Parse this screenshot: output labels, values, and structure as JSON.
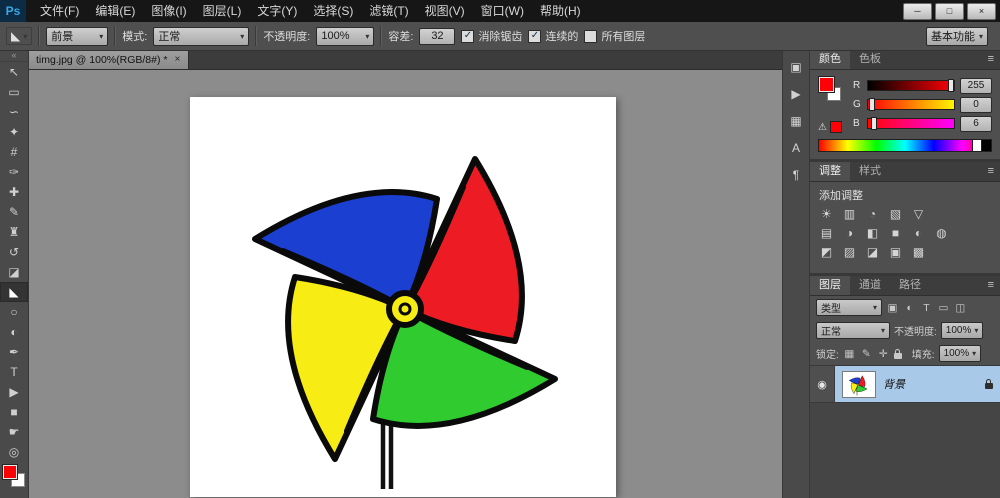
{
  "colors": {
    "foreground": "#ff0006",
    "selected_layer_bg": "#a9c9e9",
    "pinwheel": {
      "red": "#ed1c24",
      "blue": "#1b3fd0",
      "green": "#2fcb2f",
      "yellow": "#f7ec13",
      "outline": "#0a0a0a"
    }
  },
  "titlebar": {
    "logo": "Ps",
    "menus": [
      "文件(F)",
      "编辑(E)",
      "图像(I)",
      "图层(L)",
      "文字(Y)",
      "选择(S)",
      "滤镜(T)",
      "视图(V)",
      "窗口(W)",
      "帮助(H)"
    ],
    "controls": {
      "minimize": "─",
      "maximize": "□",
      "close": "×"
    }
  },
  "options": {
    "tool_icon": "◣",
    "arrow": "▾",
    "source_value": "前景",
    "mode_label": "模式:",
    "mode_value": "正常",
    "opacity_label": "不透明度:",
    "opacity_value": "100%",
    "tolerance_label": "容差:",
    "tolerance_value": "32",
    "checks": [
      {
        "label": "消除锯齿",
        "mark": "✓"
      },
      {
        "label": "连续的",
        "mark": "✓"
      },
      {
        "label": "所有图层",
        "mark": ""
      }
    ],
    "workspace": "基本功能"
  },
  "tabbar": {
    "title": "timg.jpg @ 100%(RGB/8#) *",
    "close": "×"
  },
  "toolbar": {
    "collapse": "«",
    "tools": [
      {
        "name": "move",
        "glyph": "↖"
      },
      {
        "name": "marquee",
        "glyph": "▭"
      },
      {
        "name": "lasso",
        "glyph": "∽"
      },
      {
        "name": "quick-selection",
        "glyph": "✦"
      },
      {
        "name": "crop",
        "glyph": "#"
      },
      {
        "name": "eyedropper",
        "glyph": "✑"
      },
      {
        "name": "healing-brush",
        "glyph": "✚"
      },
      {
        "name": "brush",
        "glyph": "✎"
      },
      {
        "name": "clone-stamp",
        "glyph": "♜"
      },
      {
        "name": "history-brush",
        "glyph": "↺"
      },
      {
        "name": "eraser",
        "glyph": "◪"
      },
      {
        "name": "paint-bucket",
        "glyph": "◣"
      },
      {
        "name": "blur",
        "glyph": "○"
      },
      {
        "name": "dodge",
        "glyph": "◐"
      },
      {
        "name": "pen",
        "glyph": "✒"
      },
      {
        "name": "type",
        "glyph": "T"
      },
      {
        "name": "path-selection",
        "glyph": "▶"
      },
      {
        "name": "shape",
        "glyph": "■"
      },
      {
        "name": "hand",
        "glyph": "☛"
      },
      {
        "name": "zoom",
        "glyph": "◎"
      }
    ]
  },
  "dock": {
    "items": [
      {
        "name": "history",
        "glyph": "▣"
      },
      {
        "name": "actions",
        "glyph": "▶"
      },
      {
        "name": "properties",
        "glyph": "▦"
      },
      {
        "name": "character",
        "glyph": "A"
      },
      {
        "name": "paragraph",
        "glyph": "¶"
      }
    ]
  },
  "panels": {
    "color": {
      "tab_color": "颜色",
      "tab_swatches": "色板",
      "menu": "≡",
      "warning": "⚠",
      "channels": [
        {
          "label": "R",
          "value": "255"
        },
        {
          "label": "G",
          "value": "0"
        },
        {
          "label": "B",
          "value": "6"
        }
      ]
    },
    "adjustments": {
      "tab_adjustments": "调整",
      "tab_styles": "样式",
      "menu": "≡",
      "title": "添加调整",
      "rows": [
        [
          "☀",
          "▥",
          "◔",
          "▧",
          "▽"
        ],
        [
          "▤",
          "◑",
          "◧",
          "■",
          "◐",
          "◍"
        ],
        [
          "◩",
          "▨",
          "◪",
          "▣",
          "▩"
        ]
      ]
    },
    "layers": {
      "tab_layers": "图层",
      "tab_channels": "通道",
      "tab_paths": "路径",
      "menu": "≡",
      "filter_label": "类型",
      "filter_icons": [
        "▣",
        "◐",
        "T",
        "▭",
        "◫"
      ],
      "blend_value": "正常",
      "opacity_label": "不透明度:",
      "opacity_value": "100%",
      "lock_label": "锁定:",
      "lock_icons": [
        "▦",
        "✎",
        "✛"
      ],
      "fill_label": "填充:",
      "fill_value": "100%",
      "eye": "◉",
      "layer_name": "背景",
      "arrow": "▾"
    }
  }
}
